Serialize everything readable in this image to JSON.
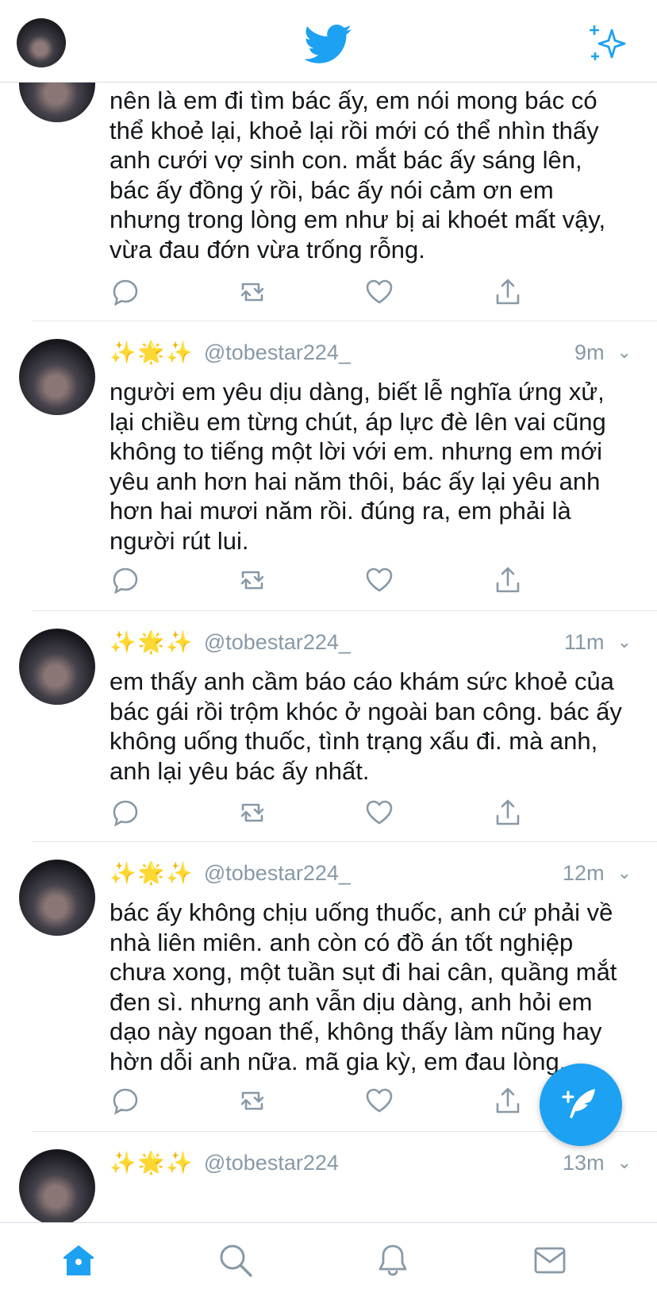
{
  "header": {
    "logo_icon": "twitter-bird-icon",
    "sparkle_icon": "sparkle-icon",
    "accent": "#1da1f2"
  },
  "feed": {
    "tweets": [
      {
        "text": "nên là em đi tìm bác ấy, em nói mong bác có thể khoẻ lại, khoẻ lại rồi mới có thể nhìn thấy anh cưới vợ sinh con. mắt bác ấy sáng lên, bác ấy đồng ý rồi, bác ấy nói cảm ơn em nhưng trong lòng em như bị ai khoét mất vậy, vừa đau đớn vừa trống rỗng."
      },
      {
        "emoji": "✨🌟✨",
        "handle": "@tobestar224_",
        "time": "9m",
        "text": "người em yêu dịu dàng, biết lễ nghĩa ứng xử, lại chiều em từng chút, áp lực đè lên vai cũng không to tiếng một lời với em. nhưng em mới yêu anh hơn hai năm thôi, bác ấy lại yêu anh hơn hai mươi năm rồi. đúng ra, em phải là người rút lui."
      },
      {
        "emoji": "✨🌟✨",
        "handle": "@tobestar224_",
        "time": "11m",
        "text": "em thấy anh cầm báo cáo khám sức khoẻ của bác gái rồi trộm khóc ở ngoài ban công. bác ấy không uống thuốc, tình trạng xấu đi. mà anh, anh lại yêu bác ấy nhất."
      },
      {
        "emoji": "✨🌟✨",
        "handle": "@tobestar224_",
        "time": "12m",
        "text": "bác ấy không chịu uống thuốc, anh cứ phải về nhà liên miên. anh còn có đồ án tốt nghiệp chưa xong, một tuần sụt đi hai cân, quầng mắt đen sì. nhưng anh vẫn dịu dàng, anh hỏi em dạo này ngoan thế, không thấy làm nũng hay hờn dỗi anh nữa. mã gia kỳ, em đau lòng."
      },
      {
        "emoji": "✨🌟✨",
        "handle": "@tobestar224",
        "time": "13m"
      }
    ]
  },
  "tabs": {
    "home_icon": "home-icon",
    "search_icon": "search-icon",
    "notifications_icon": "bell-icon",
    "messages_icon": "mail-icon"
  },
  "compose": {
    "icon": "compose-tweet-icon"
  }
}
